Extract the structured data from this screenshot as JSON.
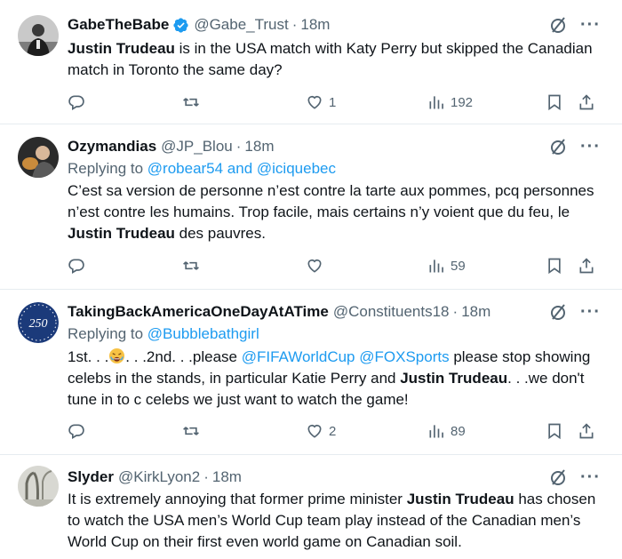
{
  "tweets": [
    {
      "name": "GabeTheBabe",
      "handle": "@Gabe_Trust",
      "dot": "·",
      "time": "18m",
      "verified": true,
      "text_parts": [
        "Justin Trudeau",
        " is in the USA match with Katy Perry but skipped the Canadian match in Toronto the same day?"
      ],
      "replies": "",
      "reposts": "",
      "likes": "1",
      "views": "192"
    },
    {
      "name": "Ozymandias",
      "handle": "@JP_Blou",
      "dot": "·",
      "time": "18m",
      "reply_prefix": "Replying to ",
      "reply_to": "@robear54 and @iciquebec",
      "text_parts": [
        "C’est sa version de personne n’est contre la tarte aux pommes, pcq personnes n’est contre les humains. Trop facile, mais certains n’y voient que du feu, le ",
        "Justin Trudeau",
        " des pauvres."
      ],
      "replies": "",
      "reposts": "",
      "likes": "",
      "views": "59"
    },
    {
      "name": "TakingBackAmericaOneDayAtATime",
      "handle": "@Constituents18",
      "dot": "·",
      "time": "18m",
      "reply_prefix": "Replying to ",
      "reply_to": "@Bubblebathgirl",
      "text_parts": [
        "1st. . .",
        ". . .2nd. . .please ",
        "@FIFAWorldCup",
        " ",
        "@FOXSports",
        " please stop showing celebs in the stands, in particular Katie Perry and ",
        "Justin Trudeau",
        ". . .we don't tune in to c celebs we just want to watch the game!"
      ],
      "replies": "",
      "reposts": "",
      "likes": "2",
      "views": "89",
      "avatar_text": "250"
    },
    {
      "name": "Slyder",
      "handle": "@KirkLyon2",
      "dot": "·",
      "time": "18m",
      "text_parts": [
        "It is extremely annoying that former prime minister ",
        "Justin Trudeau",
        " has chosen to watch the USA men’s World Cup team play instead of the Canadian men’s World Cup on their first even world game on Canadian soil."
      ]
    }
  ],
  "more_glyph": "···",
  "colors": {
    "link": "#1d9bf0",
    "muted": "#536471",
    "text": "#0f1419",
    "divider": "#e6ecf0"
  },
  "icons": [
    "verified-badge-icon",
    "grok-slash-icon",
    "more-icon",
    "reply-icon",
    "repost-icon",
    "like-icon",
    "views-icon",
    "bookmark-icon",
    "share-icon",
    "tired-face-emoji"
  ]
}
